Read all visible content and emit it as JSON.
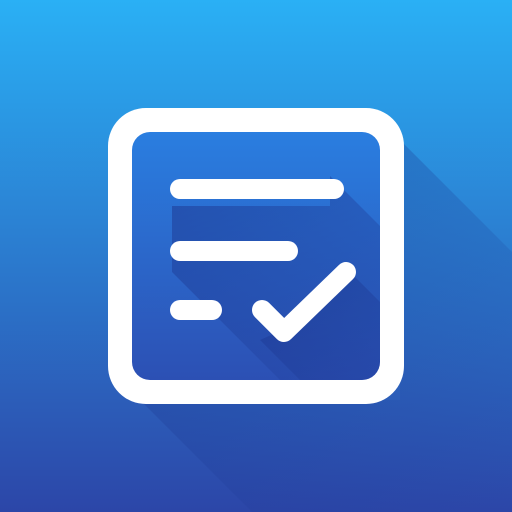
{
  "icon": {
    "name": "checklist-app-icon",
    "symbol": "task-list-with-checkmark-icon",
    "colors": {
      "background_top": "#2ab0f5",
      "background_bottom": "#2c46a8",
      "frame": "#ffffff",
      "inner_top": "#2a7ee0",
      "inner_bottom": "#2c50b4",
      "shadow": "#1c3690",
      "glyph": "#ffffff"
    }
  }
}
